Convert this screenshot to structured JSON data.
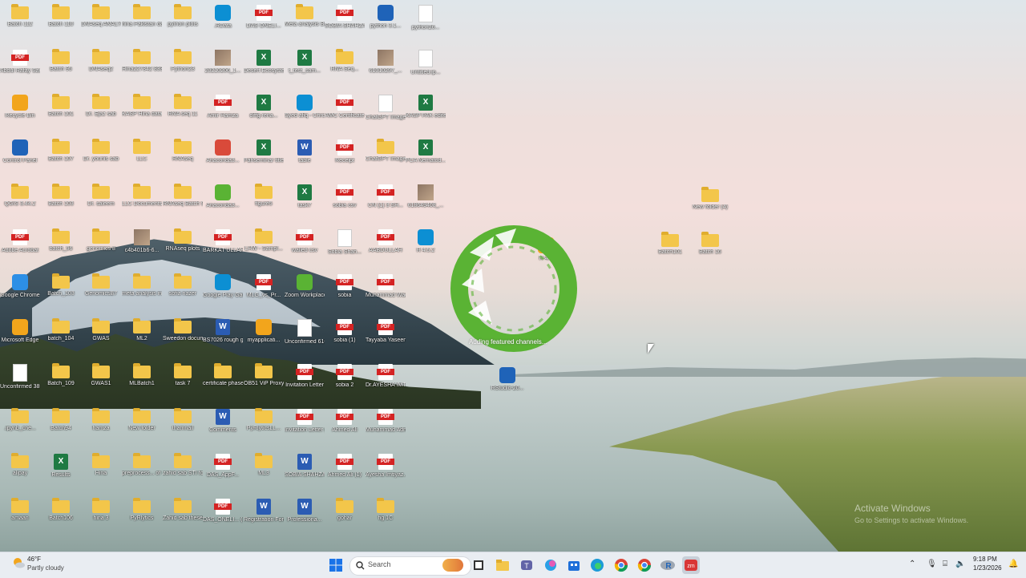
{
  "desktop_icons": [
    {
      "label": "Batch 112",
      "type": "folder"
    },
    {
      "label": "Batch 110",
      "type": "folder"
    },
    {
      "label": "DNAseq ANALYSIS IMP",
      "type": "folder"
    },
    {
      "label": "hina Pakistan data",
      "type": "folder"
    },
    {
      "label": "python plots",
      "type": "folder"
    },
    {
      "label": ".RData",
      "type": "app"
    },
    {
      "label": "DAS ONELI...",
      "type": "pdf"
    },
    {
      "label": "Meta analysis B1",
      "type": "folder"
    },
    {
      "label": "SOBIA SHAHZADI",
      "type": "pdf"
    },
    {
      "label": "python 3.1...",
      "type": "app"
    },
    {
      "label": "python26...",
      "type": "file"
    },
    {
      "label": "Abdul Rafay Saeed",
      "type": "pdf"
    },
    {
      "label": "Batch 95",
      "type": "folder"
    },
    {
      "label": "DNAseq2",
      "type": "folder"
    },
    {
      "label": "Hina227342 8333885",
      "type": "folder"
    },
    {
      "label": "Python23",
      "type": "folder"
    },
    {
      "label": "20210206_1...",
      "type": "img"
    },
    {
      "label": "Desert Ecosystem...",
      "type": "xls"
    },
    {
      "label": "t_test_sam...",
      "type": "xls"
    },
    {
      "label": "RNA Seq...",
      "type": "folder"
    },
    {
      "label": "61010297_...",
      "type": "img"
    },
    {
      "label": "Untitled.ip...",
      "type": "file"
    },
    {
      "label": "Recycle Bin",
      "type": "app"
    },
    {
      "label": "Batch 101",
      "type": "folder"
    },
    {
      "label": "Dr. Ejaz sab",
      "type": "folder"
    },
    {
      "label": "KASP Hina data",
      "type": "folder"
    },
    {
      "label": "RNA seq 11",
      "type": "folder"
    },
    {
      "label": "Amir Hamza",
      "type": "pdf"
    },
    {
      "label": "diffg rena...",
      "type": "xls"
    },
    {
      "label": "Syed afiq - Chrome",
      "type": "app"
    },
    {
      "label": "AMC Certificate",
      "type": "pdf"
    },
    {
      "label": "ChatGPT Image Jan 1...",
      "type": "file"
    },
    {
      "label": "KASP PAK edited (1)",
      "type": "xls"
    },
    {
      "label": "Control Panel",
      "type": "app"
    },
    {
      "label": "Batch 107",
      "type": "folder"
    },
    {
      "label": "Dr. younis sab",
      "type": "folder"
    },
    {
      "label": "LLC",
      "type": "folder"
    },
    {
      "label": "RNAseq",
      "type": "folder"
    },
    {
      "label": "Anaconda3...",
      "type": "app"
    },
    {
      "label": "Pahseminar title",
      "type": "xls"
    },
    {
      "label": "table",
      "type": "doc"
    },
    {
      "label": "Receipt",
      "type": "pdf"
    },
    {
      "label": "ChatGPT Image Jan 1...",
      "type": "folder"
    },
    {
      "label": "PCA Nematod...",
      "type": "xls"
    },
    {
      "label": "QGIS 3.44.2",
      "type": "folder"
    },
    {
      "label": "Batch 103",
      "type": "folder"
    },
    {
      "label": "Dr. saleem",
      "type": "folder"
    },
    {
      "label": "LLC Documents",
      "type": "folder"
    },
    {
      "label": "RNAseq Batch 9",
      "type": "folder"
    },
    {
      "label": "Anaconda3...",
      "type": "app"
    },
    {
      "label": "figure5",
      "type": "folder"
    },
    {
      "label": "task7",
      "type": "xls"
    },
    {
      "label": "sobia csv",
      "type": "pdf"
    },
    {
      "label": "CN (1) 3 SH...",
      "type": "pdf"
    },
    {
      "label": "618649408_...",
      "type": "img"
    },
    {
      "label": "Adobe Acrobat",
      "type": "pdf"
    },
    {
      "label": "batch_96",
      "type": "folder"
    },
    {
      "label": "genomics 8",
      "type": "folder"
    },
    {
      "label": "c4b401b6-6...",
      "type": "img"
    },
    {
      "label": "RNAseq plots",
      "type": "folder"
    },
    {
      "label": "BARKAT ULLAH (1)",
      "type": "pdf"
    },
    {
      "label": "LHW - Sampl...",
      "type": "folder"
    },
    {
      "label": "walled csv",
      "type": "pdf"
    },
    {
      "label": "Sobia Shah...",
      "type": "file"
    },
    {
      "label": "AABDULLAH",
      "type": "pdf"
    },
    {
      "label": "R 4.5.2",
      "type": "app"
    },
    {
      "label": "Google Chrome",
      "type": "app"
    },
    {
      "label": "Batch_103",
      "type": "folder"
    },
    {
      "label": "GenomicsB7",
      "type": "folder"
    },
    {
      "label": "meta analysis in R",
      "type": "folder"
    },
    {
      "label": "sofia nazer",
      "type": "folder"
    },
    {
      "label": "Google Play Games",
      "type": "app"
    },
    {
      "label": "MLG_vs_Pr...",
      "type": "pdf"
    },
    {
      "label": "Zoom Workplace",
      "type": "app"
    },
    {
      "label": "sobia",
      "type": "pdf"
    },
    {
      "label": "Muhammad Waqas",
      "type": "pdf"
    },
    {
      "label": "Microsoft Edge",
      "type": "app"
    },
    {
      "label": "batch_104",
      "type": "folder"
    },
    {
      "label": "GWAS",
      "type": "folder"
    },
    {
      "label": "ML2",
      "type": "folder"
    },
    {
      "label": "Sweedon documents",
      "type": "folder"
    },
    {
      "label": "BS7026 rough guide indivi...",
      "type": "doc"
    },
    {
      "label": "myapplicati...",
      "type": "app"
    },
    {
      "label": "Unconfirmed 616073.crdo...",
      "type": "file"
    },
    {
      "label": "sobia (1)",
      "type": "pdf"
    },
    {
      "label": "Tayyaba Yaseen",
      "type": "pdf"
    },
    {
      "label": "Unconfirmed 385207.crdo...",
      "type": "file"
    },
    {
      "label": "Batch_109",
      "type": "folder"
    },
    {
      "label": "GWAS1",
      "type": "folder"
    },
    {
      "label": "MLBatch1",
      "type": "folder"
    },
    {
      "label": "task 7",
      "type": "folder"
    },
    {
      "label": "certificate phase 2",
      "type": "folder"
    },
    {
      "label": "OB51 ViP Proxy Server",
      "type": "folder"
    },
    {
      "label": "Invitation Letter",
      "type": "pdf"
    },
    {
      "label": "sobia 2",
      "type": "pdf"
    },
    {
      "label": "Dr.AYESHA IMTIYAZ ...",
      "type": "pdf"
    },
    {
      "label": ".ipynb_che...",
      "type": "folder"
    },
    {
      "label": "Batch94",
      "type": "folder"
    },
    {
      "label": "hamza",
      "type": "folder"
    },
    {
      "label": "New folder",
      "type": "folder"
    },
    {
      "label": "thamnail",
      "type": "folder"
    },
    {
      "label": "Comments",
      "type": "doc"
    },
    {
      "label": "PyRlyticsLL...",
      "type": "folder"
    },
    {
      "label": "Invitation Letter (1)",
      "type": "pdf"
    },
    {
      "label": "Ahmed Ali",
      "type": "pdf"
    },
    {
      "label": "Muhammad Adnan Afzal",
      "type": "pdf"
    },
    {
      "label": "alipay",
      "type": "folder"
    },
    {
      "label": "Results",
      "type": "xls"
    },
    {
      "label": "Hina",
      "type": "folder"
    },
    {
      "label": "preprocess... of data",
      "type": "folder"
    },
    {
      "label": "zahid sab STI form",
      "type": "folder"
    },
    {
      "label": "DAS_AppF...",
      "type": "pdf"
    },
    {
      "label": "ML3",
      "type": "folder"
    },
    {
      "label": "SOBIA SHAHZADI",
      "type": "doc"
    },
    {
      "label": "Ahmed Ali (1)",
      "type": "pdf"
    },
    {
      "label": "Ayesha Imtiyaz...",
      "type": "pdf"
    },
    {
      "label": "amaan",
      "type": "folder"
    },
    {
      "label": "Batch106",
      "type": "folder"
    },
    {
      "label": "hina 3",
      "type": "folder"
    },
    {
      "label": "PyRlytics",
      "type": "folder"
    },
    {
      "label": "Zahid sab theseis",
      "type": "folder"
    },
    {
      "label": "DAS_ONELI... (1)",
      "type": "pdf"
    },
    {
      "label": "Registration Form",
      "type": "doc"
    },
    {
      "label": "Professiona...",
      "type": "doc"
    },
    {
      "label": "gohar",
      "type": "folder"
    },
    {
      "label": "fig 1C",
      "type": "folder"
    },
    {
      "label": "New folder (4)",
      "type": "folder"
    },
    {
      "label": "Batch101",
      "type": "folder"
    },
    {
      "label": "Batch 16",
      "type": "folder"
    },
    {
      "label": "RStudio-20...",
      "type": "app"
    },
    {
      "label": "R-4...",
      "type": "app"
    }
  ],
  "splash": {
    "status": "Adding featured channels..."
  },
  "watermark": {
    "title": "Activate Windows",
    "subtitle": "Go to Settings to activate Windows."
  },
  "taskbar": {
    "weather_temp": "46°F",
    "weather_desc": "Partly cloudy",
    "search_label": "Search",
    "time": "9:18 PM",
    "date": "1/23/2026",
    "apps": [
      "start-icon",
      "search",
      "task-view-icon",
      "file-explorer-icon",
      "teams-icon",
      "copilot-icon",
      "store-icon",
      "edge-icon",
      "chrome-icon",
      "chrome-icon",
      "r-icon",
      "zoom-icon"
    ]
  },
  "colors": {
    "folder": "#f3c64a",
    "pdf": "#d42323",
    "excel": "#1f7a43",
    "word": "#2b5cb3",
    "anaconda": "#5ab334"
  }
}
